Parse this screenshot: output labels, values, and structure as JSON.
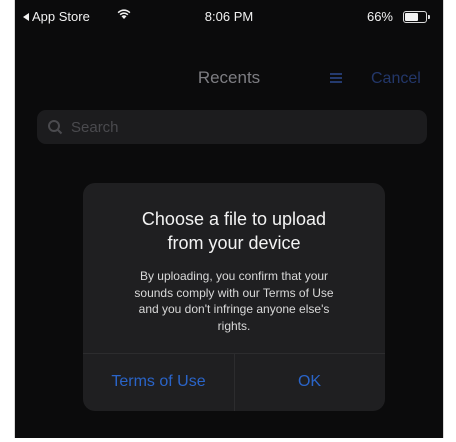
{
  "status_bar": {
    "back_app": "App Store",
    "time": "8:06 PM",
    "battery_percent": "66%",
    "battery_level": 0.66
  },
  "background": {
    "title": "Recents",
    "cancel": "Cancel",
    "search_placeholder": "Search"
  },
  "alert": {
    "title_line1": "Choose a file to upload",
    "title_line2": "from your device",
    "message_lines": [
      "By uploading, you confirm that your",
      "sounds comply with our Terms of Use",
      "and you don't infringe anyone else's",
      "rights."
    ],
    "buttons": {
      "terms": "Terms of Use",
      "ok": "OK"
    },
    "accent_color": "#2a64c8"
  }
}
